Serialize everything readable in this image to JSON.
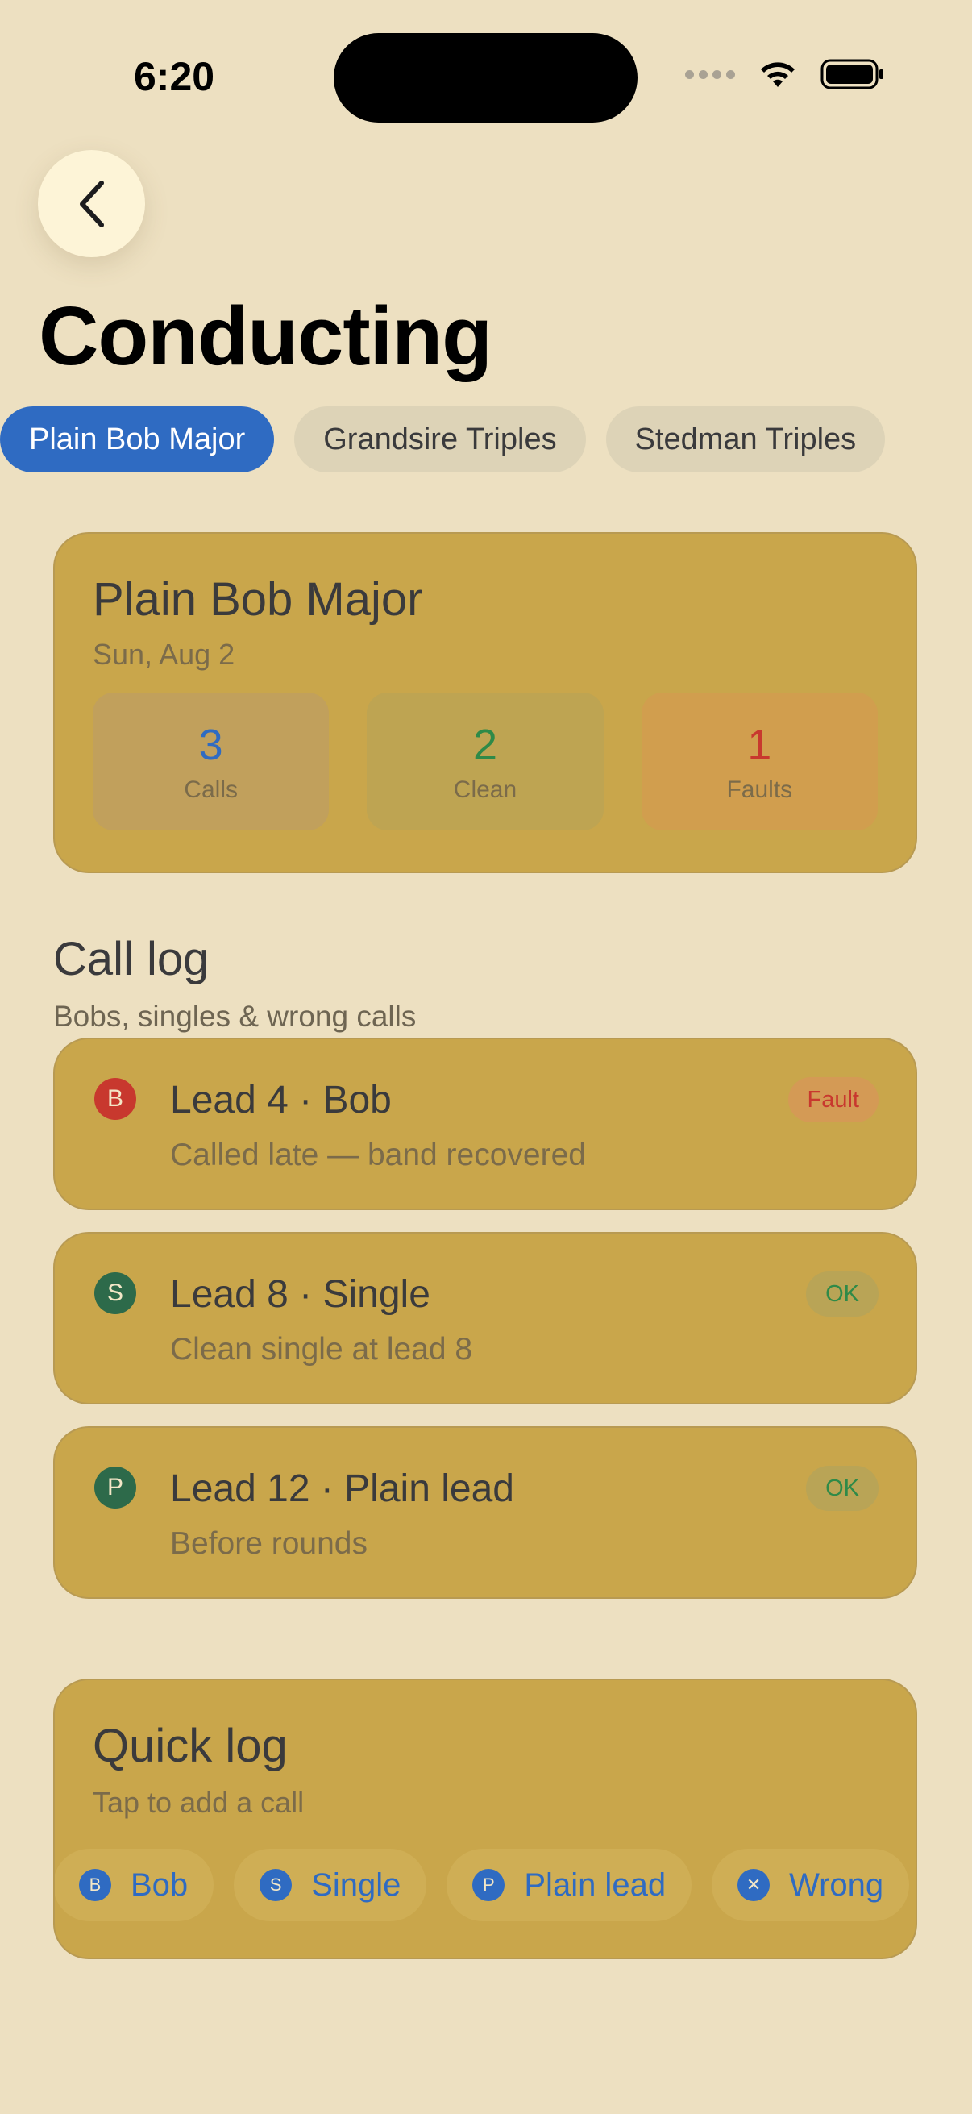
{
  "status_bar": {
    "time": "6:20"
  },
  "header": {
    "title": "Conducting"
  },
  "tabs": [
    {
      "label": "Plain Bob Major",
      "active": true
    },
    {
      "label": "Grandsire Triples",
      "active": false
    },
    {
      "label": "Stedman Triples",
      "active": false
    }
  ],
  "summary": {
    "title": "Plain Bob Major",
    "date": "Sun, Aug 2",
    "stats": [
      {
        "value": "3",
        "label": "Calls"
      },
      {
        "value": "2",
        "label": "Clean"
      },
      {
        "value": "1",
        "label": "Faults"
      }
    ]
  },
  "call_log": {
    "title": "Call log",
    "subtitle": "Bobs, singles & wrong calls",
    "items": [
      {
        "letter": "B",
        "title": "Lead 4 · Bob",
        "desc": "Called late — band recovered",
        "status": "Fault",
        "color": "#C8382E"
      },
      {
        "letter": "S",
        "title": "Lead 8 · Single",
        "desc": "Clean single at lead 8",
        "status": "OK",
        "color": "#2D6A4A"
      },
      {
        "letter": "P",
        "title": "Lead 12 · Plain lead",
        "desc": "Before rounds",
        "status": "OK",
        "color": "#2D6A4A"
      }
    ]
  },
  "quick_log": {
    "title": "Quick log",
    "subtitle": "Tap to add a call",
    "chips": [
      {
        "icon": "B",
        "label": "Bob"
      },
      {
        "icon": "S",
        "label": "Single"
      },
      {
        "icon": "P",
        "label": "Plain lead"
      },
      {
        "icon": "✕",
        "label": "Wrong"
      }
    ]
  },
  "colors": {
    "background": "#EDE0C1",
    "card": "#C9A64B",
    "accent": "#2F6BC2"
  }
}
